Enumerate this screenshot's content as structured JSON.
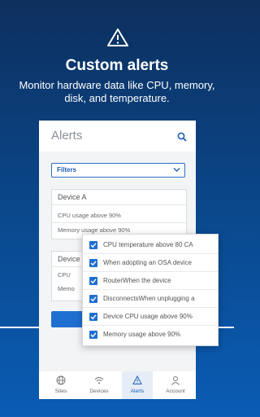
{
  "hero": {
    "title": "Custom alerts",
    "subtitle": "Monitor hardware data like CPU, memory, disk, and temperature."
  },
  "screen": {
    "title": "Alerts",
    "filters_label": "Filters",
    "cards": [
      {
        "name": "Device A",
        "rows": [
          "CPU usage above 90%",
          "Memory usage above 90%"
        ]
      },
      {
        "name": "Device",
        "rows": [
          "CPU",
          "Memo"
        ]
      }
    ],
    "tabs": [
      {
        "label": "Sites",
        "icon": "globe-icon",
        "active": false
      },
      {
        "label": "Devices",
        "icon": "wifi-icon",
        "active": false
      },
      {
        "label": "Alerts",
        "icon": "alert-icon",
        "active": true
      },
      {
        "label": "Account",
        "icon": "user-icon",
        "active": false
      }
    ]
  },
  "dropdown": {
    "options": [
      {
        "label": "CPU temperature above 80 CA",
        "checked": true
      },
      {
        "label": "When adopting an OSA device",
        "checked": true
      },
      {
        "label": "RouterWhen the device",
        "checked": true
      },
      {
        "label": "DisconnectsWhen unplugging a",
        "checked": true
      },
      {
        "label": "Device CPU usage above 90%",
        "checked": true
      },
      {
        "label": "Memory usage above 90%",
        "checked": true
      }
    ]
  },
  "colors": {
    "accent": "#1f6fd1",
    "background_top": "#0d2f5e",
    "background_bottom": "#0a5cb5"
  }
}
